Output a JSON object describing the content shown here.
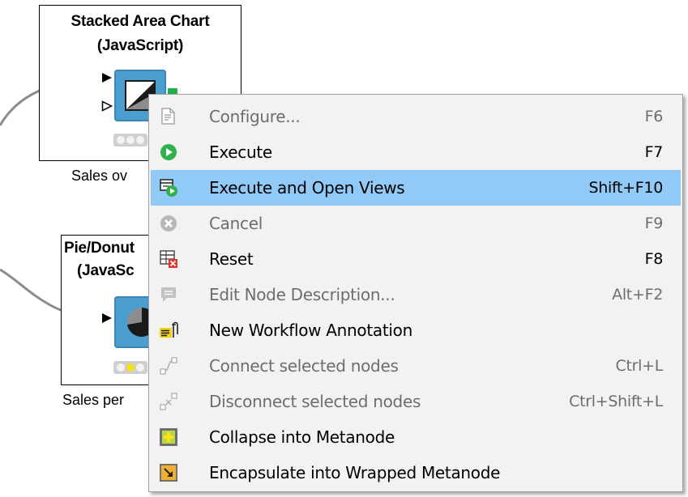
{
  "nodes": [
    {
      "title_line1": "Stacked Area Chart",
      "title_line2": "(JavaScript)",
      "label": "Sales ov",
      "icon": "area-chart-icon"
    },
    {
      "title_line1": "Pie/Donut",
      "title_line2": "(JavaSc",
      "label": "Sales per",
      "icon": "pie-chart-icon"
    }
  ],
  "menu": {
    "items": [
      {
        "label": "Configure...",
        "shortcut": "F6",
        "icon": "configure-icon",
        "enabled": false
      },
      {
        "label": "Execute",
        "shortcut": "F7",
        "icon": "execute-icon",
        "enabled": true
      },
      {
        "label": "Execute and Open Views",
        "shortcut": "Shift+F10",
        "icon": "execute-open-views-icon",
        "enabled": true,
        "highlighted": true
      },
      {
        "label": "Cancel",
        "shortcut": "F9",
        "icon": "cancel-icon",
        "enabled": false
      },
      {
        "label": "Reset",
        "shortcut": "F8",
        "icon": "reset-icon",
        "enabled": true
      },
      {
        "label": "Edit Node Description...",
        "shortcut": "Alt+F2",
        "icon": "edit-description-icon",
        "enabled": false
      },
      {
        "label": "New Workflow Annotation",
        "shortcut": "",
        "icon": "annotation-icon",
        "enabled": true
      },
      {
        "label": "Connect selected nodes",
        "shortcut": "Ctrl+L",
        "icon": "connect-nodes-icon",
        "enabled": false
      },
      {
        "label": "Disconnect selected nodes",
        "shortcut": "Ctrl+Shift+L",
        "icon": "disconnect-nodes-icon",
        "enabled": false
      },
      {
        "label": "Collapse into Metanode",
        "shortcut": "",
        "icon": "collapse-metanode-icon",
        "enabled": true
      },
      {
        "label": "Encapsulate into Wrapped Metanode",
        "shortcut": "",
        "icon": "wrapped-metanode-icon",
        "enabled": true
      }
    ]
  },
  "colors": {
    "highlight": "#91c9f7",
    "node_icon": "#4a9ed0",
    "execute_green": "#2fb24b",
    "port_green": "#21b14a",
    "menu_background": "#f2f2f2"
  }
}
